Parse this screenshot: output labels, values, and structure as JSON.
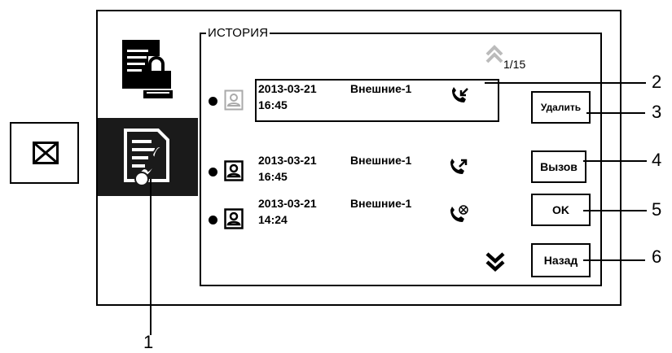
{
  "screen": {
    "title": "ИСТОРИЯ",
    "page_indicator": "1/15",
    "sidebar": [
      {
        "name": "intercom-settings",
        "icon": "monitor-lock-icon",
        "active": false
      },
      {
        "name": "call-history",
        "icon": "document-phone-icon",
        "active": true
      },
      {
        "name": "empty",
        "icon": "",
        "active": false
      }
    ],
    "rows": [
      {
        "date": "2013-03-21",
        "time": "16:45",
        "source": "Внешние-1",
        "call_icon": "incoming-call-icon",
        "selected": true
      },
      {
        "date": "2013-03-21",
        "time": "16:45",
        "source": "Внешние-1",
        "call_icon": "outgoing-call-icon",
        "selected": false
      },
      {
        "date": "2013-03-21",
        "time": "14:24",
        "source": "Внешние-1",
        "call_icon": "missed-call-icon",
        "selected": false
      }
    ],
    "buttons": {
      "delete": "Удалить",
      "call": "Вызов",
      "ok": "OK",
      "back": "Назад"
    }
  },
  "callouts": [
    "1",
    "2",
    "3",
    "4",
    "5",
    "6"
  ],
  "mail_icon": "envelope-icon"
}
